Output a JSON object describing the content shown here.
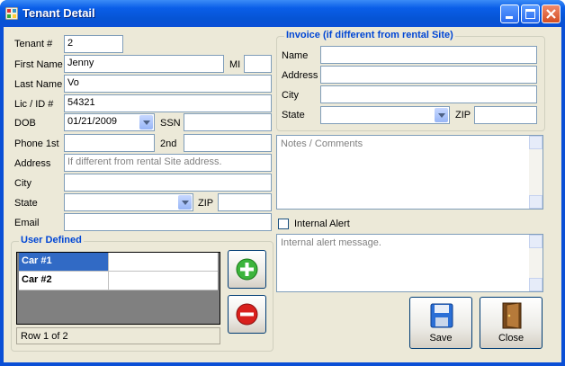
{
  "window": {
    "title": "Tenant Detail"
  },
  "tenant": {
    "tenant_no_label": "Tenant #",
    "tenant_no": "2",
    "first_name_label": "First Name",
    "first_name": "Jenny",
    "mi_label": "MI",
    "mi": "",
    "last_name_label": "Last Name",
    "last_name": "Vo",
    "lic_label": "Lic / ID #",
    "lic": "54321",
    "dob_label": "DOB",
    "dob": "01/21/2009",
    "ssn_label": "SSN",
    "ssn": "",
    "phone1_label": "Phone 1st",
    "phone1": "",
    "phone2_label": "2nd",
    "phone2": "",
    "address_label": "Address",
    "address_placeholder": "If different from rental Site address.",
    "city_label": "City",
    "city": "",
    "state_label": "State",
    "state": "",
    "zip_label": "ZIP",
    "zip": "",
    "email_label": "Email",
    "email": ""
  },
  "user_defined": {
    "title": "User Defined",
    "rows": [
      {
        "name": "Car #1",
        "value": ""
      },
      {
        "name": "Car #2",
        "value": ""
      }
    ],
    "status": "Row 1 of 2"
  },
  "invoice": {
    "title": "Invoice (if different from rental Site)",
    "name_label": "Name",
    "address_label": "Address",
    "city_label": "City",
    "state_label": "State",
    "zip_label": "ZIP"
  },
  "notes": {
    "placeholder": "Notes / Comments"
  },
  "alert": {
    "label": "Internal Alert",
    "checked": false,
    "placeholder": "Internal alert message."
  },
  "buttons": {
    "save": "Save",
    "close": "Close"
  },
  "colors": {
    "titlebar": "#0a4fd6",
    "group_title": "#0046d5",
    "selection": "#316ac5",
    "add": "#3cb43c",
    "remove": "#d9201d"
  },
  "icons": {
    "add": "plus-circle-icon",
    "remove": "minus-circle-icon",
    "save": "floppy-disk-icon",
    "close": "door-icon"
  }
}
